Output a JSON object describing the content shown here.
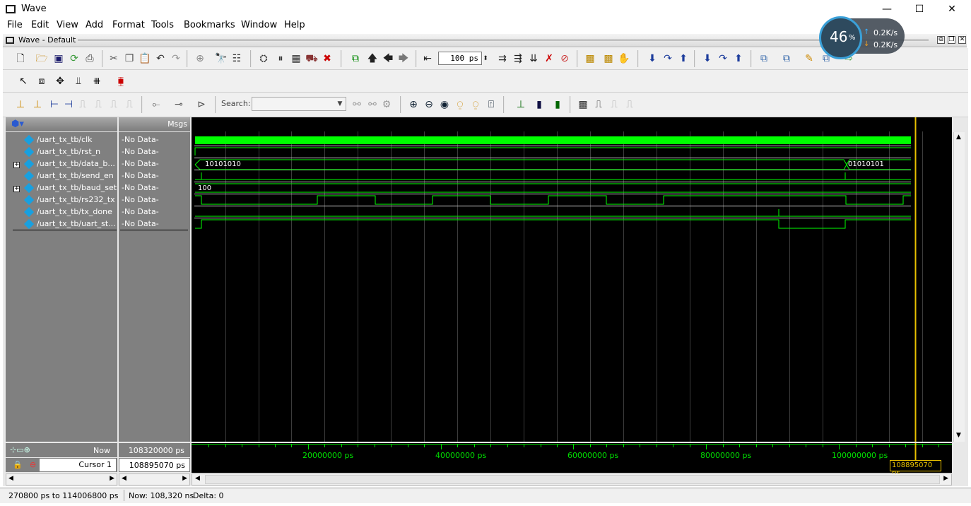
{
  "window": {
    "title": "Wave",
    "minimize": "—",
    "maximize": "☐",
    "close": "✕"
  },
  "menu": [
    "File",
    "Edit",
    "View",
    "Add",
    "Format",
    "Tools",
    "Bookmarks",
    "Window",
    "Help"
  ],
  "subwindow": {
    "title": "Wave - Default"
  },
  "toolbar": {
    "run_length": "100 ps",
    "search_label": "Search:",
    "search_value": ""
  },
  "net_widget": {
    "percent": "46",
    "percent_unit": "%",
    "up": "0.2K/s",
    "down": "0.2K/s"
  },
  "header": {
    "msgs": "Msgs"
  },
  "signals": [
    {
      "name": "/uart_tx_tb/clk",
      "msg": "-No Data-",
      "expandable": false
    },
    {
      "name": "/uart_tx_tb/rst_n",
      "msg": "-No Data-",
      "expandable": false
    },
    {
      "name": "/uart_tx_tb/data_b...",
      "msg": "-No Data-",
      "expandable": true
    },
    {
      "name": "/uart_tx_tb/send_en",
      "msg": "-No Data-",
      "expandable": false
    },
    {
      "name": "/uart_tx_tb/baud_set",
      "msg": "-No Data-",
      "expandable": true
    },
    {
      "name": "/uart_tx_tb/rs232_tx",
      "msg": "-No Data-",
      "expandable": false
    },
    {
      "name": "/uart_tx_tb/tx_done",
      "msg": "-No Data-",
      "expandable": false
    },
    {
      "name": "/uart_tx_tb/uart_st...",
      "msg": "-No Data-",
      "expandable": false
    }
  ],
  "wave_labels": {
    "data_byte_1": "10101010",
    "data_byte_2": "01010101",
    "baud_set": "100"
  },
  "time_axis": [
    "20000000 ps",
    "40000000 ps",
    "60000000 ps",
    "80000000 ps",
    "100000000 ps"
  ],
  "now": {
    "label": "Now",
    "value": "108320000 ps"
  },
  "cursor": {
    "label": "Cursor 1",
    "value": "108895070 ps",
    "marker": "108895070 ps"
  },
  "status": {
    "range": "270800 ps to 114006800 ps",
    "now": "Now: 108,320 ns",
    "delta": "Delta: 0"
  },
  "colors": {
    "wave": "#00ff00",
    "cursor": "#e8c000",
    "background": "#000000",
    "panel": "#808080"
  }
}
